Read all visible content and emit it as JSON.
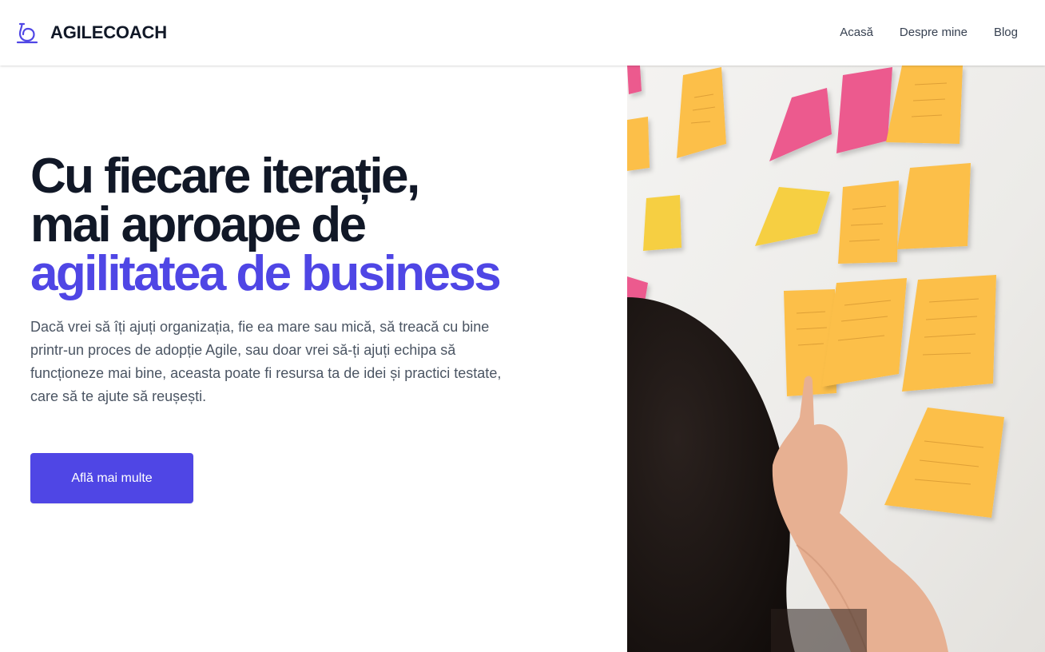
{
  "header": {
    "brand_name": "AGILECOACH",
    "brand_icon": "loop-logo-icon",
    "nav": [
      {
        "label": "Acasă"
      },
      {
        "label": "Despre mine"
      },
      {
        "label": "Blog"
      }
    ]
  },
  "hero": {
    "headline_line1": "Cu fiecare iterație,",
    "headline_line2": "mai aproape de",
    "headline_accent": "agilitatea de business",
    "description": "Dacă vrei să îți ajuți organizația, fie ea mare sau mică, să treacă cu bine printr-un proces de adopție Agile, sau doar vrei să-ți ajuți echipa să funcționeze mai bine, aceasta poate fi resursa ta de idei și practici testate, care să te ajute să reușești.",
    "cta_label": "Află mai multe",
    "image_subject": "sticky-notes-wall-photo"
  },
  "colors": {
    "accent": "#4f46e5",
    "heading": "#111827",
    "body_text": "#4b5563",
    "sticky_yellow": "#fcbf49",
    "sticky_pink": "#ec5a8e"
  }
}
